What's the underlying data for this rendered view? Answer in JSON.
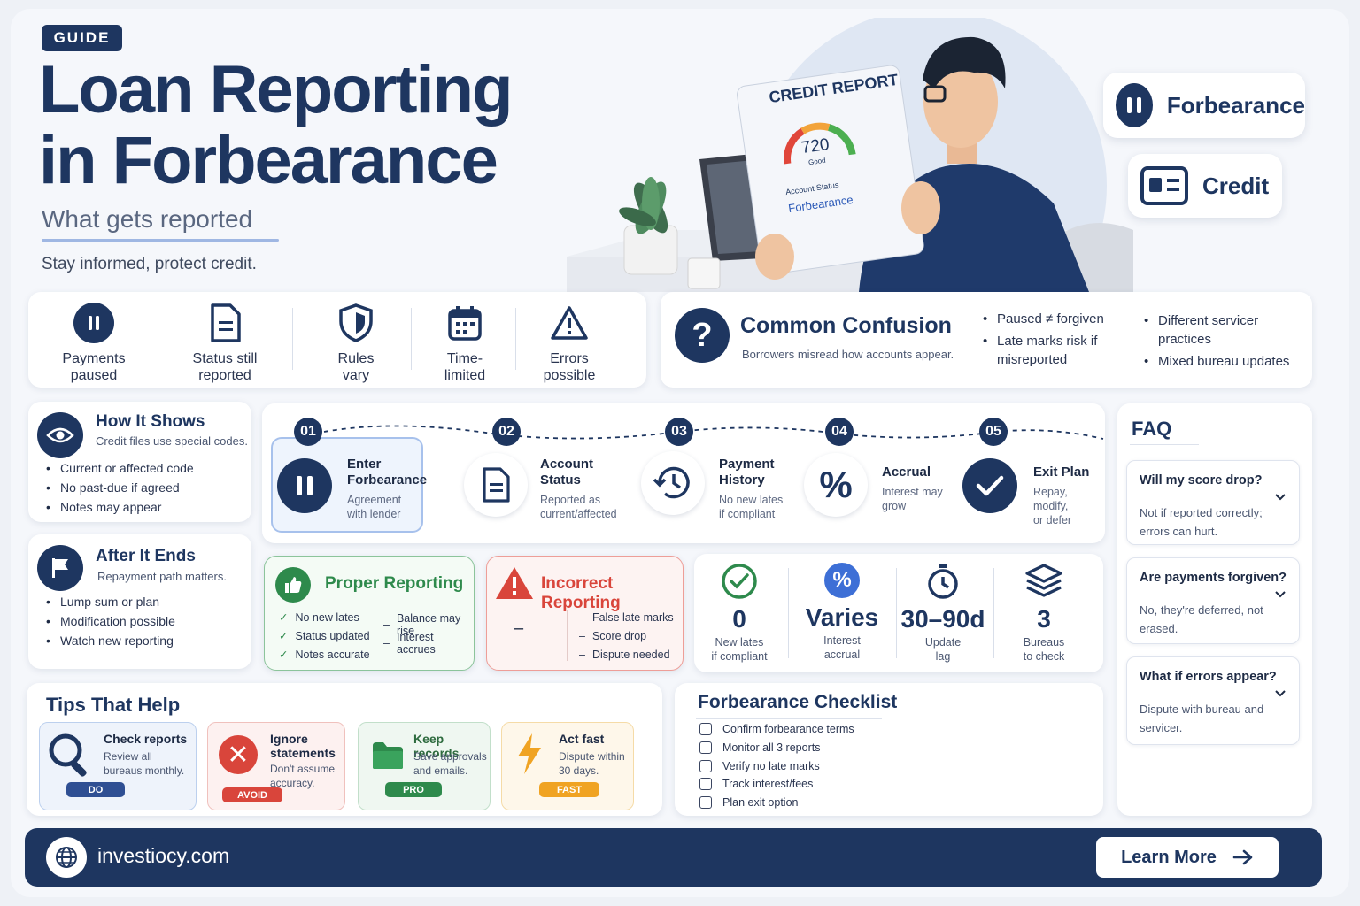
{
  "header": {
    "badge": "GUIDE",
    "title_line1": "Loan Reporting",
    "title_line2": "in Forbearance",
    "subtitle": "What gets reported",
    "tagline": "Stay informed, protect credit."
  },
  "illustration": {
    "report_title": "CREDIT REPORT",
    "score": "720",
    "score_label": "Good",
    "account_status_label": "Account Status",
    "account_status_value": "Forbearance"
  },
  "pills": {
    "forbearance": "Forbearance",
    "credit": "Credit"
  },
  "key_facts": [
    {
      "line1": "Payments",
      "line2": "paused",
      "icon": "pause-icon"
    },
    {
      "line1": "Status still",
      "line2": "reported",
      "icon": "document-icon"
    },
    {
      "line1": "Rules",
      "line2": "vary",
      "icon": "shield-icon"
    },
    {
      "line1": "Time-",
      "line2": "limited",
      "icon": "calendar-icon"
    },
    {
      "line1": "Errors",
      "line2": "possible",
      "icon": "warning-icon"
    }
  ],
  "confusion": {
    "title": "Common Confusion",
    "subtitle": "Borrowers misread how accounts appear.",
    "col1": [
      "Paused ≠ forgiven",
      "Late marks risk if misreported"
    ],
    "col2": [
      "Different servicer practices",
      "Mixed bureau updates"
    ]
  },
  "how_it_shows": {
    "title": "How It Shows",
    "subtitle": "Credit files use special codes.",
    "items": [
      "Current or affected code",
      "No past-due if agreed",
      "Notes may appear"
    ]
  },
  "after_it_ends": {
    "title": "After It Ends",
    "subtitle": "Repayment path matters.",
    "items": [
      "Lump sum or plan",
      "Modification possible",
      "Watch new reporting"
    ]
  },
  "steps": [
    {
      "num": "01",
      "title1": "Enter",
      "title2": "Forbearance",
      "sub1": "Agreement",
      "sub2": "with lender",
      "icon": "pause-icon"
    },
    {
      "num": "02",
      "title1": "Account",
      "title2": "Status",
      "sub1": "Reported as",
      "sub2": "current/affected",
      "icon": "document-icon"
    },
    {
      "num": "03",
      "title1": "Payment",
      "title2": "History",
      "sub1": "No new lates",
      "sub2": "if compliant",
      "icon": "history-icon"
    },
    {
      "num": "04",
      "title1": "Accrual",
      "title2": "",
      "sub1": "Interest may",
      "sub2": "grow",
      "icon": "percent-icon"
    },
    {
      "num": "05",
      "title1": "Exit Plan",
      "title2": "",
      "sub1": "Repay, modify,",
      "sub2": "or defer",
      "icon": "check-circle-icon"
    }
  ],
  "proper_reporting": {
    "title": "Proper Reporting",
    "checks": [
      "No new lates",
      "Status updated",
      "Notes accurate"
    ],
    "dashes": [
      "Balance may rise",
      "Interest accrues"
    ]
  },
  "incorrect_reporting": {
    "title": "Incorrect Reporting",
    "mark": "–",
    "dashes": [
      "False late marks",
      "Score drop",
      "Dispute needed"
    ]
  },
  "metrics": [
    {
      "big": "0",
      "line1": "New lates",
      "line2": "if compliant",
      "icon": "check-circle-icon"
    },
    {
      "big": "Varies",
      "line1": "Interest",
      "line2": "accrual",
      "icon": "percent-icon"
    },
    {
      "big": "30–90d",
      "line1": "Update",
      "line2": "lag",
      "icon": "stopwatch-icon"
    },
    {
      "big": "3",
      "line1": "Bureaus",
      "line2": "to check",
      "icon": "layers-icon"
    }
  ],
  "tips": {
    "title": "Tips That Help",
    "items": [
      {
        "title1": "Check reports",
        "title2": "",
        "sub1": "Review all",
        "sub2": "bureaus monthly.",
        "tag": "DO",
        "color": "#2f4f93"
      },
      {
        "title1": "Ignore",
        "title2": "statements",
        "sub1": "Don't assume",
        "sub2": "accuracy.",
        "tag": "AVOID",
        "color": "#d9453b"
      },
      {
        "title1": "Keep records",
        "title2": "",
        "sub1": "Save approvals",
        "sub2": "and emails.",
        "tag": "PRO",
        "color": "#2e8a4c"
      },
      {
        "title1": "Act fast",
        "title2": "",
        "sub1": "Dispute within",
        "sub2": "30 days.",
        "tag": "FAST",
        "color": "#f0a322"
      }
    ]
  },
  "checklist": {
    "title": "Forbearance Checklist",
    "items": [
      "Confirm forbearance terms",
      "Monitor all 3 reports",
      "Verify no late marks",
      "Track interest/fees",
      "Plan exit option"
    ]
  },
  "faq": {
    "title": "FAQ",
    "items": [
      {
        "q": "Will my score drop?",
        "a": "Not if reported correctly; errors can hurt."
      },
      {
        "q": "Are payments forgiven?",
        "a": "No, they're deferred, not erased."
      },
      {
        "q": "What if errors appear?",
        "a": "Dispute with bureau and servicer."
      }
    ]
  },
  "footer": {
    "site": "investiocy.com",
    "cta": "Learn More"
  },
  "colors": {
    "navy": "#1e3660",
    "green": "#2e8a4c",
    "red": "#d9453b",
    "amber": "#f0a322",
    "blue": "#3d6fd6"
  }
}
